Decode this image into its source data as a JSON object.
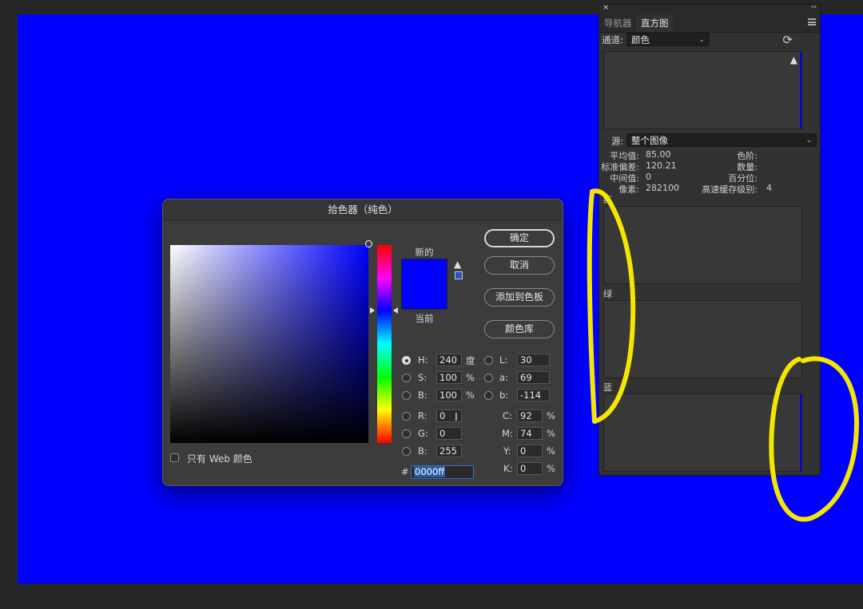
{
  "histogram_panel": {
    "close_glyph": "×",
    "collapse_glyph": "‹‹",
    "tabs": [
      {
        "label": "导航器"
      },
      {
        "label": "直方图"
      }
    ],
    "channel_label": "通道:",
    "channel_value": "颜色",
    "source_label": "源:",
    "source_value": "整个图像",
    "stats": {
      "mean_label": "平均值:",
      "mean": "85.00",
      "stddev_label": "标准偏差:",
      "stddev": "120.21",
      "median_label": "中间值:",
      "median": "0",
      "pixels_label": "像素:",
      "pixels": "282100",
      "level_label": "色阶:",
      "count_label": "数量:",
      "percentile_label": "百分位:",
      "cache_label": "高速缓存级别:",
      "cache": "4"
    },
    "channels": [
      {
        "label": "红"
      },
      {
        "label": "绿"
      },
      {
        "label": "蓝"
      }
    ]
  },
  "color_picker": {
    "title": "拾色器（纯色）",
    "new_label": "新的",
    "current_label": "当前",
    "buttons": {
      "ok": "确定",
      "cancel": "取消",
      "add_swatch": "添加到色板",
      "libraries": "颜色库"
    },
    "hsb": [
      {
        "label": "H:",
        "value": "240",
        "unit": "度"
      },
      {
        "label": "S:",
        "value": "100",
        "unit": "%"
      },
      {
        "label": "B:",
        "value": "100",
        "unit": "%"
      }
    ],
    "lab": [
      {
        "label": "L:",
        "value": "30"
      },
      {
        "label": "a:",
        "value": "69"
      },
      {
        "label": "b:",
        "value": "-114"
      }
    ],
    "rgb": [
      {
        "label": "R:",
        "value": "0"
      },
      {
        "label": "G:",
        "value": "0"
      },
      {
        "label": "B:",
        "value": "255"
      }
    ],
    "cmyk": [
      {
        "label": "C:",
        "value": "92",
        "unit": "%"
      },
      {
        "label": "M:",
        "value": "74",
        "unit": "%"
      },
      {
        "label": "Y:",
        "value": "0",
        "unit": "%"
      },
      {
        "label": "K:",
        "value": "0",
        "unit": "%"
      }
    ],
    "hex_label": "#",
    "hex_value": "0000ff",
    "web_only_label": "只有 Web 颜色"
  },
  "colors": {
    "canvas": "#0000ff",
    "picked": "#0000ff",
    "annotation": "#f5e600",
    "panel_bg": "#323232",
    "dialog_bg": "#3c3c3c"
  }
}
